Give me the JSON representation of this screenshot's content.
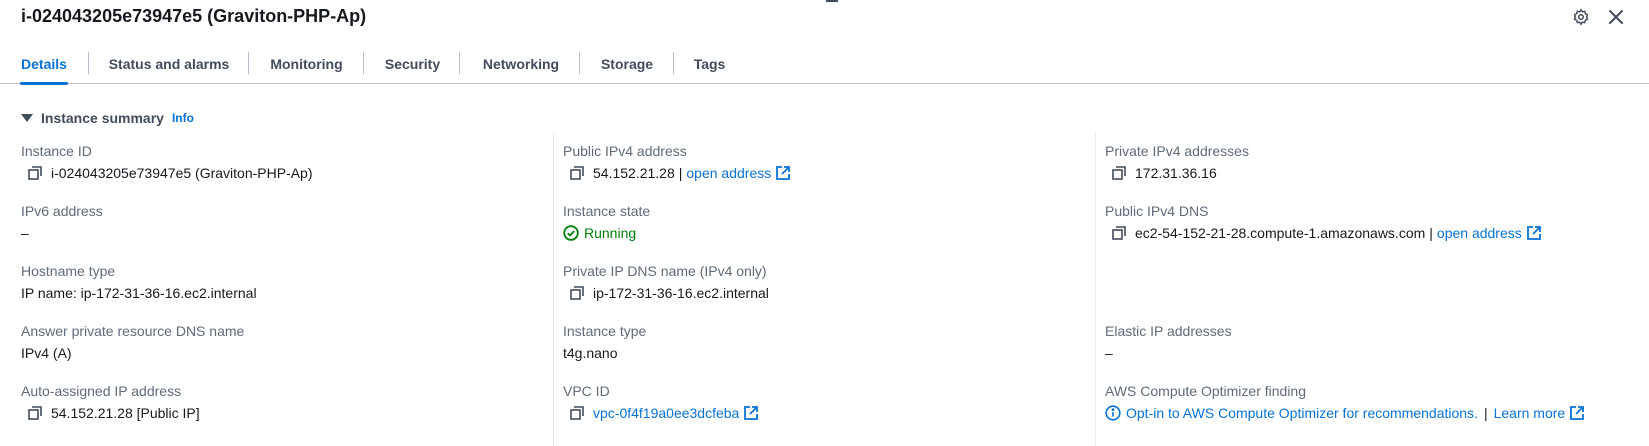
{
  "header": {
    "title": "i-024043205e73947e5 (Graviton-PHP-Ap)",
    "settings_icon": "gear-icon",
    "close_icon": "close-icon"
  },
  "tabs": [
    {
      "label": "Details",
      "active": true
    },
    {
      "label": "Status and alarms"
    },
    {
      "label": "Monitoring"
    },
    {
      "label": "Security"
    },
    {
      "label": "Networking"
    },
    {
      "label": "Storage"
    },
    {
      "label": "Tags"
    }
  ],
  "section": {
    "title": "Instance summary",
    "info": "Info"
  },
  "fields": {
    "instance_id": {
      "label": "Instance ID",
      "value": "i-024043205e73947e5 (Graviton-PHP-Ap)"
    },
    "ipv6": {
      "label": "IPv6 address",
      "value": "–"
    },
    "hostname_type": {
      "label": "Hostname type",
      "value": "IP name: ip-172-31-36-16.ec2.internal"
    },
    "answer_dns": {
      "label": "Answer private resource DNS name",
      "value": "IPv4 (A)"
    },
    "auto_ip": {
      "label": "Auto-assigned IP address",
      "value": "54.152.21.28 [Public IP]"
    },
    "public_ipv4": {
      "label": "Public IPv4 address",
      "value": "54.152.21.28",
      "sep": "|",
      "link": "open address"
    },
    "instance_state": {
      "label": "Instance state",
      "value": "Running"
    },
    "private_dns": {
      "label": "Private IP DNS name (IPv4 only)",
      "value": "ip-172-31-36-16.ec2.internal"
    },
    "instance_type": {
      "label": "Instance type",
      "value": "t4g.nano"
    },
    "vpc_id": {
      "label": "VPC ID",
      "value": "vpc-0f4f19a0ee3dcfeba"
    },
    "private_ipv4": {
      "label": "Private IPv4 addresses",
      "value": "172.31.36.16"
    },
    "public_dns": {
      "label": "Public IPv4 DNS",
      "value": "ec2-54-152-21-28.compute-1.amazonaws.com",
      "sep": "|",
      "link": "open address"
    },
    "elastic_ip": {
      "label": "Elastic IP addresses",
      "value": "–"
    },
    "optimizer": {
      "label": "AWS Compute Optimizer finding",
      "link": "Opt-in to AWS Compute Optimizer for recommendations.",
      "sep": "|",
      "learn_more": "Learn more"
    }
  },
  "colors": {
    "link": "#0972d3",
    "running": "#037f0c",
    "label": "#5f6b7a",
    "text": "#16191f"
  }
}
